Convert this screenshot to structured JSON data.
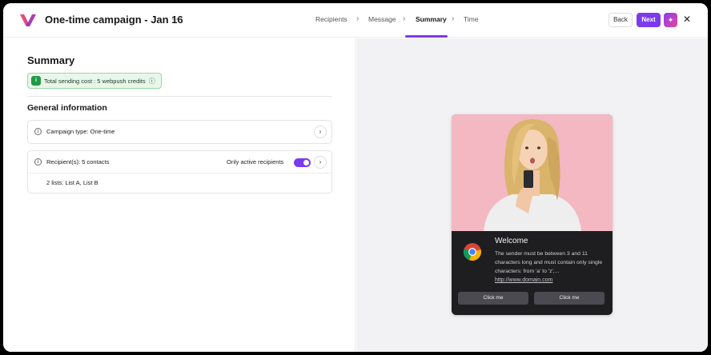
{
  "header": {
    "title": "One-time campaign - Jan 16",
    "more": "···",
    "steps": [
      "Recipients",
      "Message",
      "Summary",
      "Time"
    ],
    "active_step": "Summary",
    "back_label": "Back",
    "next_label": "Next",
    "ai_label": "✦",
    "close_label": "✕"
  },
  "summary": {
    "title": "Summary",
    "cost_badge": "Total sending cost : 5 webpush credits",
    "general_title": "General information",
    "campaign_type": "Campaign type: One-time",
    "recipients": "Recipient(s): 5 contacts",
    "only_active_label": "Only active recipients",
    "only_active_on": true,
    "lists": "2 lists: List A, List B"
  },
  "preview": {
    "title": "Welcome",
    "text": "The sender must be between 3 and 11 characters long and must contain only single characters: from 'a' to 'z',...",
    "link": "http://www.domain.com",
    "button1": "Click me",
    "button2": "Click me"
  },
  "colors": {
    "accent": "#7c3aed",
    "success_bg": "#e8f7ea",
    "success": "#1f9a45",
    "preview_bg": "#f2f2f4",
    "notif_bg": "#1e1e20",
    "photo_bg": "#f3b8c2"
  }
}
